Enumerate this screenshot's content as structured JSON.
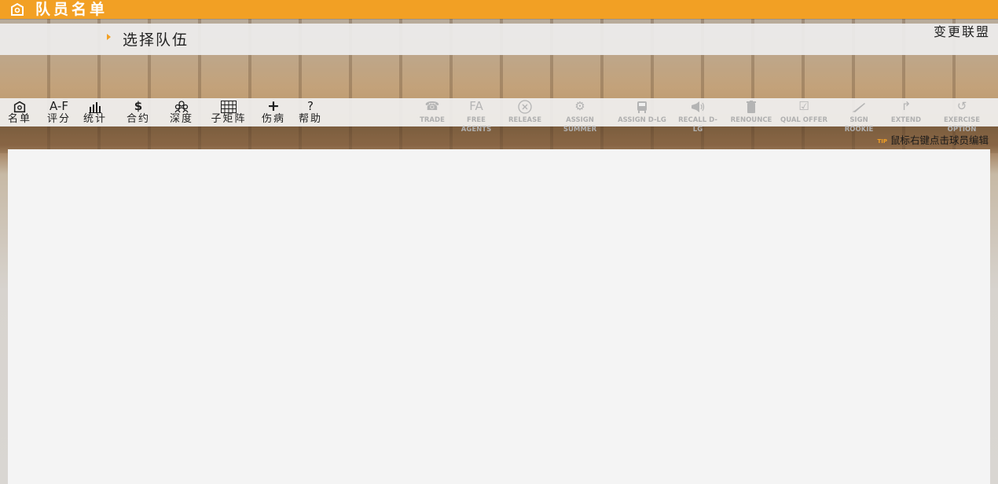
{
  "header": {
    "title": "队员名单",
    "icon": "roster-icon"
  },
  "subheader": {
    "select_team": "选择队伍",
    "change_league": "变更联盟"
  },
  "toolbar": {
    "tools": [
      {
        "icon": "roster-icon",
        "label": "名单"
      },
      {
        "icon_text": "A-F",
        "label": "评分"
      },
      {
        "icon": "stats-bars-icon",
        "label": "统计"
      },
      {
        "icon_text": "$",
        "label": "合约"
      },
      {
        "icon": "depth-people-icon",
        "label": "深度"
      },
      {
        "icon": "grid-icon",
        "label": "子矩阵"
      },
      {
        "icon_text": "+",
        "label": "伤病"
      },
      {
        "icon_text": "?",
        "label": "帮助"
      }
    ],
    "actions": [
      {
        "icon": "phone-icon",
        "label": "TRADE"
      },
      {
        "icon_text": "FA",
        "label": "FREE AGENTS"
      },
      {
        "icon": "release-x-icon",
        "label": "RELEASE"
      },
      {
        "icon": "gear-icon",
        "label": "ASSIGN SUMMER"
      },
      {
        "icon": "bus-icon",
        "label": "ASSIGN D-LG"
      },
      {
        "icon": "megaphone-icon",
        "label": "RECALL D-LG"
      },
      {
        "icon": "trash-icon",
        "label": "RENOUNCE"
      },
      {
        "icon": "checkbox-icon",
        "label": "QUAL OFFER"
      },
      {
        "icon": "pen-icon",
        "label": "SIGN ROOKIE"
      },
      {
        "icon": "arrow-right-icon",
        "label": "EXTEND"
      },
      {
        "icon": "undo-icon",
        "label": "EXERCISE OPTION"
      }
    ]
  },
  "hint": {
    "tip": "TIP",
    "text": "鼠标右键点击球员编辑"
  },
  "colors": {
    "accent": "#f2a024",
    "panel": "#f4f4f4",
    "disabled": "#b4b4b4"
  }
}
